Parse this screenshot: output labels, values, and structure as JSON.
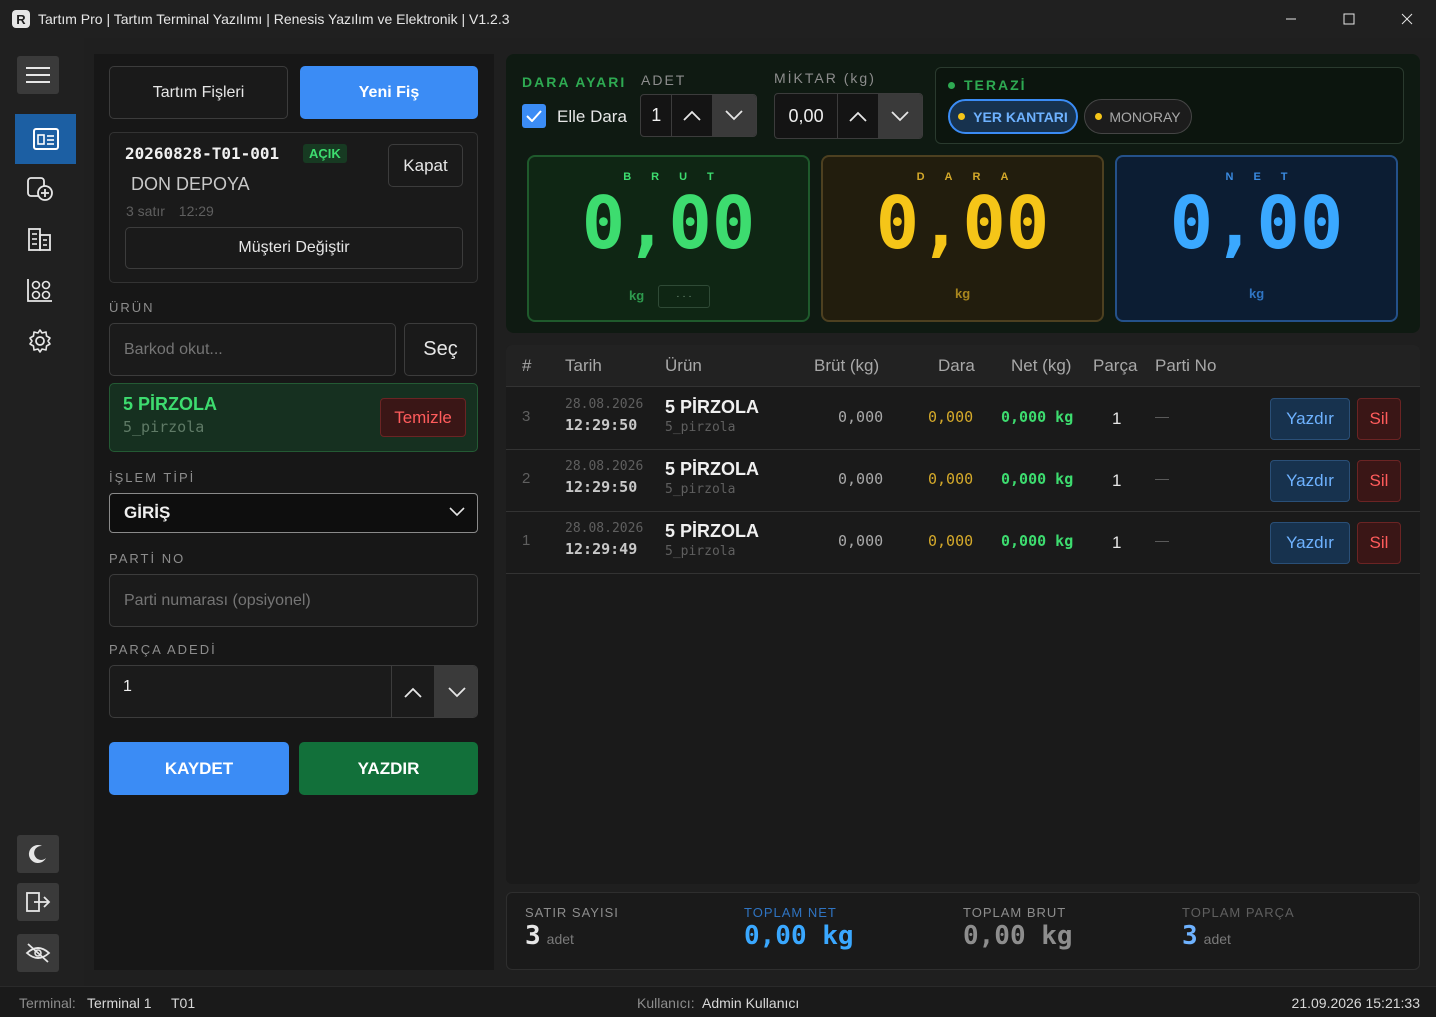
{
  "window": {
    "title": "Tartım Pro | Tartım Terminal Yazılımı | Renesis Yazılım ve Elektronik | V1.2.3",
    "logo_letter": "R"
  },
  "sidebar": {
    "icons": [
      "menu-icon",
      "dashboard-icon",
      "add-document-icon",
      "building-icon",
      "chart-people-icon",
      "gear-icon",
      "moon-icon",
      "logout-icon",
      "eye-off-icon"
    ]
  },
  "left": {
    "tab_receipts": "Tartım Fişleri",
    "tab_new": "Yeni Fiş",
    "receipt": {
      "number": "20260828-T01-001",
      "status": "AÇIK",
      "close_label": "Kapat",
      "customer": "DON DEPOYA",
      "line_count": "3 satır",
      "time": "12:29",
      "change_customer_label": "Müşteri Değiştir"
    },
    "product_section": "ÜRÜN",
    "barcode_placeholder": "Barkod okut...",
    "select_label": "Seç",
    "selected_product": {
      "name": "5 PİRZOLA",
      "code": "5_pirzola",
      "clear_label": "Temizle"
    },
    "op_type_section": "İŞLEM TİPİ",
    "op_type_value": "GİRİŞ",
    "batch_section": "PARTİ NO",
    "batch_placeholder": "Parti numarası (opsiyonel)",
    "pieces_section": "PARÇA ADEDİ",
    "pieces_value": "1",
    "save_label": "KAYDET",
    "print_label": "YAZDIR"
  },
  "top": {
    "tare_section": "DARA AYARI",
    "manual_tare_label": "Elle Dara",
    "manual_tare_checked": true,
    "count_section": "ADET",
    "count_value": "1",
    "amount_section": "MİKTAR (kg)",
    "amount_value": "0,00",
    "scale_section": "TERAZİ",
    "scales": [
      {
        "label": "YER KANTARI",
        "active": true
      },
      {
        "label": "MONORAY",
        "active": false
      }
    ],
    "gross": {
      "title": "BRUT",
      "value": "0,00",
      "unit": "kg",
      "extra": "· · ·"
    },
    "tare": {
      "title": "DARA",
      "value": "0,00",
      "unit": "kg"
    },
    "net": {
      "title": "NET",
      "value": "0,00",
      "unit": "kg"
    }
  },
  "table": {
    "headers": [
      "#",
      "Tarih",
      "Ürün",
      "Brüt (kg)",
      "Dara",
      "Net (kg)",
      "Parça",
      "Parti No"
    ],
    "print_label": "Yazdır",
    "delete_label": "Sil",
    "rows": [
      {
        "no": "3",
        "date": "28.08.2026",
        "time": "12:29:50",
        "product": "5 PİRZOLA",
        "code": "5_pirzola",
        "gross": "0,000",
        "tare": "0,000",
        "net": "0,000 kg",
        "pieces": "1",
        "batch": "—"
      },
      {
        "no": "2",
        "date": "28.08.2026",
        "time": "12:29:50",
        "product": "5 PİRZOLA",
        "code": "5_pirzola",
        "gross": "0,000",
        "tare": "0,000",
        "net": "0,000 kg",
        "pieces": "1",
        "batch": "—"
      },
      {
        "no": "1",
        "date": "28.08.2026",
        "time": "12:29:49",
        "product": "5 PİRZOLA",
        "code": "5_pirzola",
        "gross": "0,000",
        "tare": "0,000",
        "net": "0,000 kg",
        "pieces": "1",
        "batch": "—"
      }
    ]
  },
  "summary": {
    "rows_label": "SATIR SAYISI",
    "rows_value": "3",
    "rows_unit": "adet",
    "net_label": "TOPLAM NET",
    "net_value": "0,00 kg",
    "gross_label": "TOPLAM BRUT",
    "gross_value": "0,00 kg",
    "pieces_label": "TOPLAM PARÇA",
    "pieces_value": "3",
    "pieces_unit": "adet"
  },
  "status": {
    "terminal_label": "Terminal:",
    "terminal_name": "Terminal 1",
    "terminal_code": "T01",
    "user_label": "Kullanıcı:",
    "user_name": "Admin Kullanıcı",
    "datetime": "21.09.2026 15:21:33"
  },
  "colors": {
    "accent_blue": "#3b8cf5",
    "accent_green": "#12703a",
    "gross_green": "#3ddc6f",
    "tare_yellow": "#f5c518",
    "net_blue": "#3aa8ff"
  }
}
